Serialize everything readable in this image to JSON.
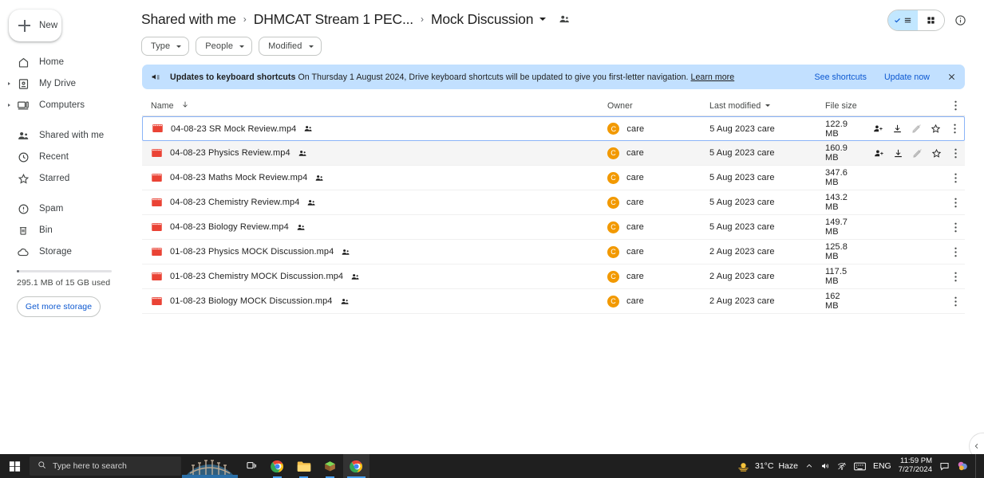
{
  "sidebar": {
    "new_button": {
      "label": "New",
      "icon": "plus-icon"
    },
    "groups": [
      {
        "items": [
          {
            "label": "Home",
            "icon": "home-icon",
            "expandable": false
          },
          {
            "label": "My Drive",
            "icon": "drive-icon",
            "expandable": true
          },
          {
            "label": "Computers",
            "icon": "computer-icon",
            "expandable": true
          }
        ]
      },
      {
        "items": [
          {
            "label": "Shared with me",
            "icon": "people-icon",
            "expandable": false
          },
          {
            "label": "Recent",
            "icon": "clock-icon",
            "expandable": false
          },
          {
            "label": "Starred",
            "icon": "star-icon",
            "expandable": false
          }
        ]
      },
      {
        "items": [
          {
            "label": "Spam",
            "icon": "spam-icon",
            "expandable": false
          },
          {
            "label": "Bin",
            "icon": "trash-icon",
            "expandable": false
          },
          {
            "label": "Storage",
            "icon": "cloud-icon",
            "expandable": false
          }
        ]
      }
    ],
    "storage": {
      "used_text": "295.1 MB of 15 GB used",
      "percent": 2,
      "button_label": "Get more storage"
    }
  },
  "header": {
    "breadcrumb": [
      {
        "label": "Shared with me"
      },
      {
        "label": "DHMCAT Stream 1 PEC..."
      },
      {
        "label": "Mock Discussion"
      }
    ],
    "separator": "›",
    "people_icon": "people-shared-icon",
    "view_toggle": {
      "list_label": "list-view",
      "grid_label": "grid-view",
      "active": "list"
    },
    "info_icon": "info-icon"
  },
  "filters": [
    {
      "label": "Type"
    },
    {
      "label": "People"
    },
    {
      "label": "Modified"
    }
  ],
  "banner": {
    "icon": "campaign-icon",
    "title": "Updates to keyboard shortcuts",
    "body": "On Thursday 1 August 2024, Drive keyboard shortcuts will be updated to give you first-letter navigation.",
    "learn_more": "Learn more",
    "see_shortcuts": "See shortcuts",
    "update_now": "Update now",
    "close_icon": "close-icon",
    "bg_color": "#c2e0ff"
  },
  "table": {
    "columns": {
      "name": "Name",
      "name_sort_icon": "arrow-down-icon",
      "owner": "Owner",
      "modified": "Last modified",
      "modified_caret": "chevron-down-icon",
      "size": "File size",
      "kebab": "more-options-icon"
    },
    "row_actions": [
      {
        "name": "share-icon"
      },
      {
        "name": "download-icon"
      },
      {
        "name": "edit-icon",
        "disabled": true
      },
      {
        "name": "star-icon"
      }
    ],
    "rows": [
      {
        "name": "04-08-23 SR Mock Review.mp4",
        "shared": true,
        "owner": "care",
        "owner_initial": "C",
        "modified": "5 Aug 2023 care",
        "size": "122.9 MB",
        "state": "selected"
      },
      {
        "name": "04-08-23 Physics Review.mp4",
        "shared": true,
        "owner": "care",
        "owner_initial": "C",
        "modified": "5 Aug 2023 care",
        "size": "160.9 MB",
        "state": "hovered"
      },
      {
        "name": "04-08-23 Maths Mock Review.mp4",
        "shared": true,
        "owner": "care",
        "owner_initial": "C",
        "modified": "5 Aug 2023 care",
        "size": "347.6 MB",
        "state": "normal"
      },
      {
        "name": "04-08-23 Chemistry Review.mp4",
        "shared": true,
        "owner": "care",
        "owner_initial": "C",
        "modified": "5 Aug 2023 care",
        "size": "143.2 MB",
        "state": "normal"
      },
      {
        "name": "04-08-23 Biology Review.mp4",
        "shared": true,
        "owner": "care",
        "owner_initial": "C",
        "modified": "5 Aug 2023 care",
        "size": "149.7 MB",
        "state": "normal"
      },
      {
        "name": "01-08-23 Physics MOCK Discussion.mp4",
        "shared": true,
        "owner": "care",
        "owner_initial": "C",
        "modified": "2 Aug 2023 care",
        "size": "125.8 MB",
        "state": "normal"
      },
      {
        "name": "01-08-23 Chemistry MOCK Discussion.mp4",
        "shared": true,
        "owner": "care",
        "owner_initial": "C",
        "modified": "2 Aug 2023 care",
        "size": "117.5 MB",
        "state": "normal"
      },
      {
        "name": "01-08-23 Biology MOCK Discussion.mp4",
        "shared": true,
        "owner": "care",
        "owner_initial": "C",
        "modified": "2 Aug 2023 care",
        "size": "162 MB",
        "state": "normal"
      }
    ]
  },
  "side_panel_toggle": {
    "icon": "chevron-left-icon"
  },
  "taskbar": {
    "start_icon": "windows-start-icon",
    "search_placeholder": "Type here to search",
    "search_icon": "search-icon",
    "widget_icon": "weather-widget-icon",
    "taskview_icon": "task-view-icon",
    "apps": [
      {
        "name": "chrome-icon",
        "state": "open"
      },
      {
        "name": "file-explorer-icon",
        "state": "open"
      },
      {
        "name": "minecraft-icon",
        "state": "open"
      },
      {
        "name": "chrome-icon",
        "state": "active"
      }
    ],
    "tray": {
      "weather_temp": "31°C",
      "weather_cond": "Haze",
      "chevron_icon": "chevron-up-icon",
      "volume_icon": "volume-icon",
      "network_icon": "network-icon",
      "keyboard_icon": "keyboard-icon",
      "language": "ENG",
      "time": "11:59 PM",
      "date": "7/27/2024",
      "notification_icon": "notification-icon",
      "extra_icon": "tray-app-icon"
    }
  },
  "colors": {
    "accent": "#0b57d0",
    "selected_border": "#8ab4f8",
    "banner_bg": "#c2e0ff",
    "avatar": "#f29900",
    "video_icon": "#ea4335"
  }
}
